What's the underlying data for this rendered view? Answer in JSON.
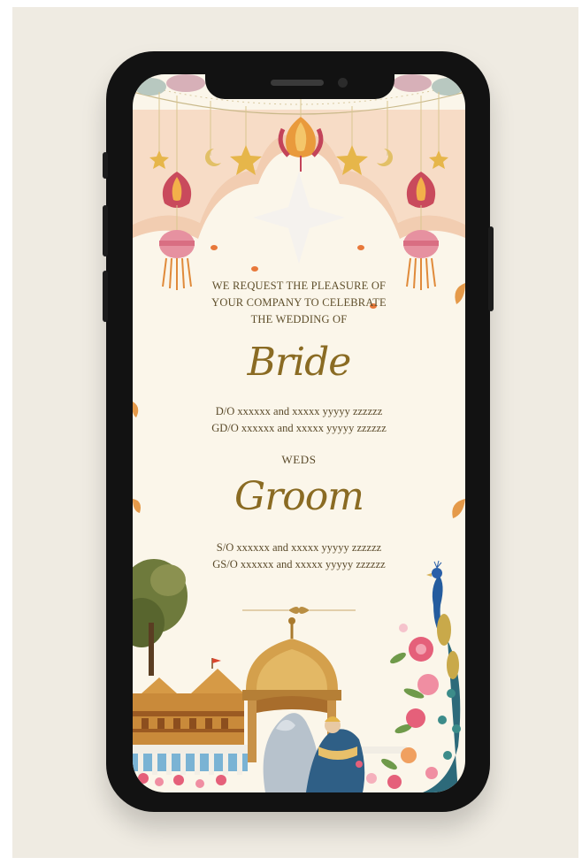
{
  "invite": {
    "request_lines": [
      "WE REQUEST THE PLEASURE OF",
      "YOUR COMPANY TO CELEBRATE",
      "THE WEDDING OF"
    ],
    "bride_name": "Bride",
    "bride_parents": [
      "D/O xxxxxx and xxxxx yyyyy zzzzzz",
      "GD/O xxxxxx and xxxxx yyyyy zzzzzz"
    ],
    "weds": "WEDS",
    "groom_name": "Groom",
    "groom_parents": [
      "S/O xxxxxx and xxxxx yyyyy zzzzzz",
      "GS/O xxxxxx and xxxxx yyyyy zzzzzz"
    ]
  },
  "colors": {
    "page_bg": "#efebe2",
    "card_bg": "#fbf6ea",
    "script_gold": "#8a6b23",
    "arch_peach": "#f7dcc6"
  },
  "icons": [
    "star-icon",
    "moon-icon",
    "lantern-icon",
    "lotus-icon",
    "peacock-icon",
    "tree-icon",
    "temple-icon",
    "pavilion-icon",
    "flower-icon"
  ]
}
